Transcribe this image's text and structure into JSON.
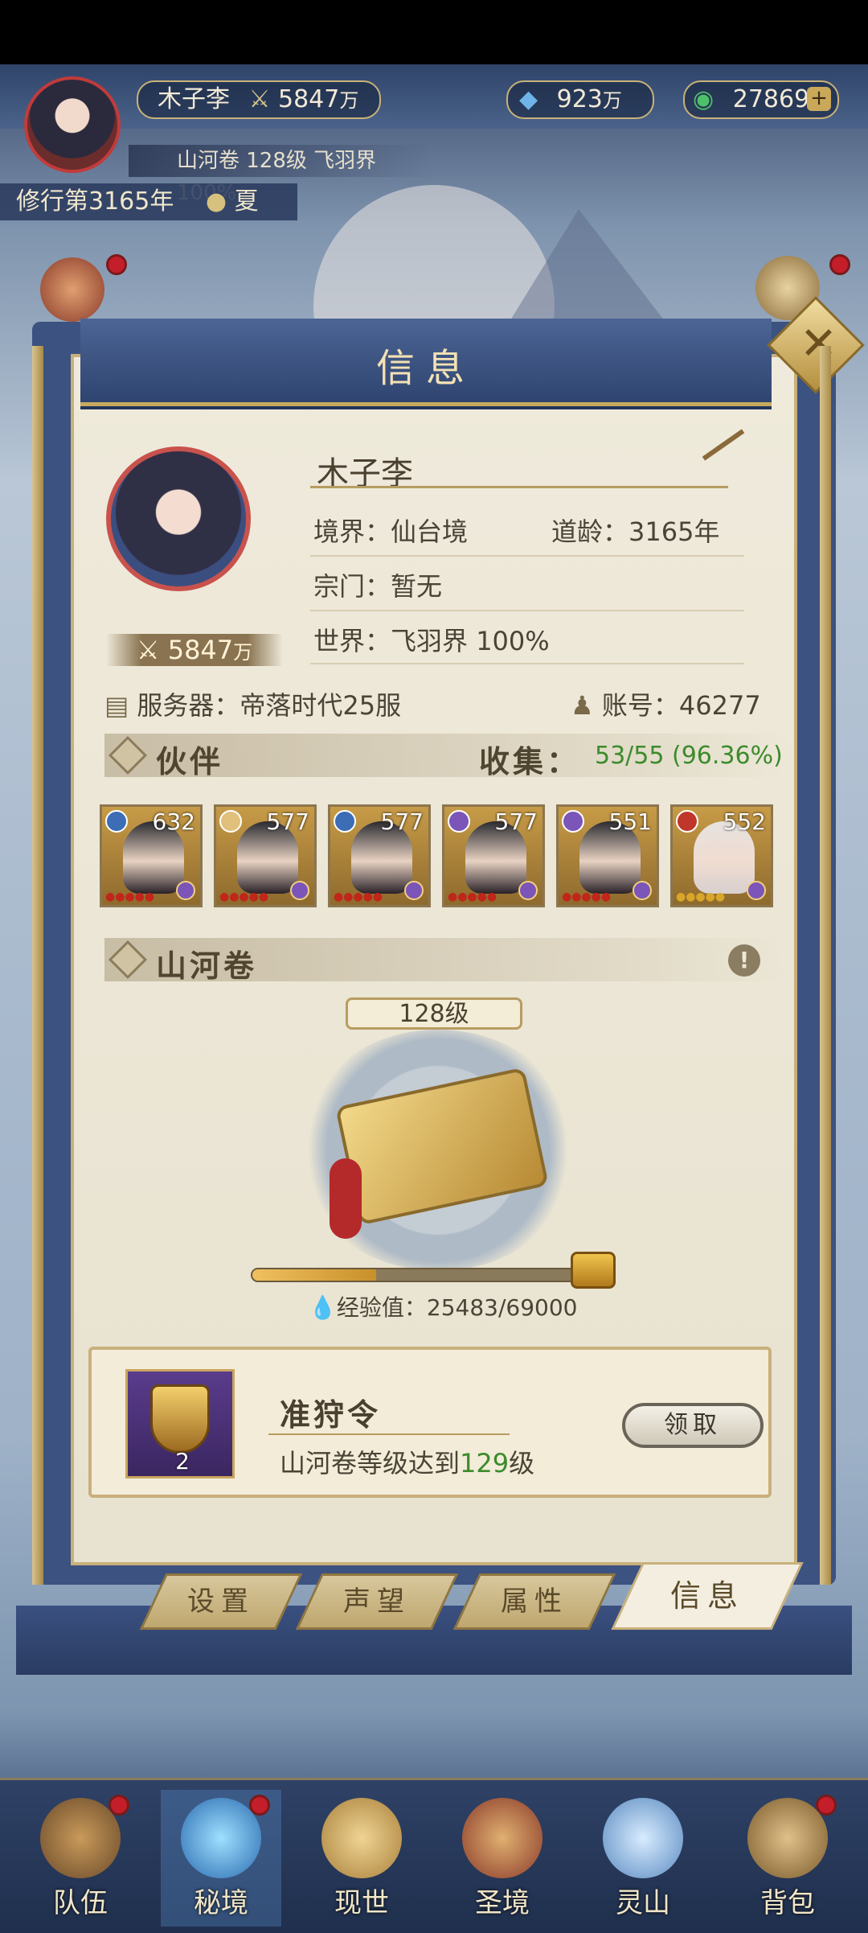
{
  "topbar": {
    "player_name": "木子李",
    "combat_power": "5847",
    "combat_unit": "万",
    "spirit_stones": "923",
    "spirit_unit": "万",
    "jade": "27869",
    "scroll_info": "山河卷 128级 飞羽界 100%",
    "cultivation_year": "修行第3165年",
    "season": "夏"
  },
  "dialog": {
    "title": "信息",
    "close_icon": "close-icon"
  },
  "profile": {
    "name": "木子李",
    "power": "5847",
    "power_unit": "万",
    "realm_label": "境界：",
    "realm": "仙台境",
    "age_label": "道龄：",
    "age": "3165年",
    "sect_label": "宗门：",
    "sect": "暂无",
    "world_label": "世界：",
    "world": "飞羽界 100%",
    "server_label": "服务器：",
    "server": "帝落时代25服",
    "account_label": "账号：",
    "account": "46277"
  },
  "partners": {
    "title": "伙伴",
    "collect_label": "收集：",
    "collect_value": "53/55 (96.36%)",
    "accent": "#3c8b2c",
    "cards": [
      {
        "level": "632",
        "element_color": "#3c6db5"
      },
      {
        "level": "577",
        "element_color": "#e0c07a"
      },
      {
        "level": "577",
        "element_color": "#3c6db5"
      },
      {
        "level": "577",
        "element_color": "#7b55b8"
      },
      {
        "level": "551",
        "element_color": "#7b55b8"
      },
      {
        "level": "552",
        "element_color": "#c0362a"
      }
    ]
  },
  "scroll": {
    "title": "山河卷",
    "info_icon": "info-icon",
    "level": "128级",
    "progress": 0.369,
    "exp_label": "经验值：",
    "exp_value": "25483/69000"
  },
  "task": {
    "badge_count": "2",
    "title": "准狩令",
    "desc_prefix": "山河卷等级达到",
    "desc_level": "129",
    "desc_suffix": "级",
    "button": "领取"
  },
  "tabs": [
    {
      "label": "设置"
    },
    {
      "label": "声望"
    },
    {
      "label": "属性"
    },
    {
      "label": "信息"
    }
  ],
  "nav": [
    {
      "label": "队伍"
    },
    {
      "label": "秘境"
    },
    {
      "label": "现世"
    },
    {
      "label": "圣境"
    },
    {
      "label": "灵山"
    },
    {
      "label": "背包"
    }
  ]
}
